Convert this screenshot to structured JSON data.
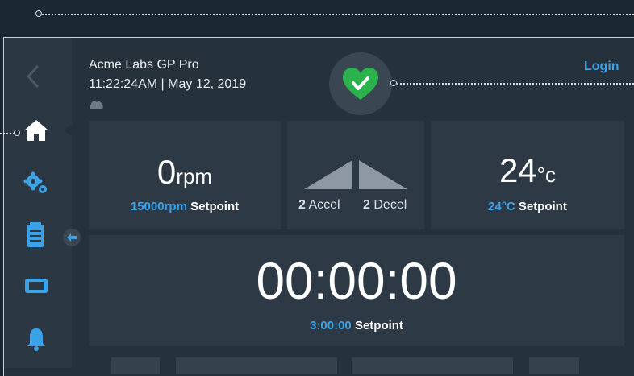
{
  "header": {
    "title": "Acme Labs GP Pro",
    "datetime": "11:22:24AM | May 12, 2019",
    "login_label": "Login"
  },
  "icons": {
    "back": "chevron-left-icon",
    "home": "home-icon",
    "settings": "gears-icon",
    "programs": "clipboard-icon",
    "rotor": "rotor-icon",
    "alerts": "bell-icon",
    "collapse": "arrow-left-icon",
    "cloud": "cloud-icon",
    "status": "heart-check-icon"
  },
  "speed": {
    "value": "0",
    "unit": "rpm",
    "setpoint_value": "15000rpm",
    "setpoint_label": "Setpoint"
  },
  "ramp": {
    "accel_value": "2",
    "accel_label": "Accel",
    "decel_value": "2",
    "decel_label": "Decel"
  },
  "temperature": {
    "value": "24",
    "unit": "°c",
    "setpoint_value": "24°C",
    "setpoint_label": "Setpoint"
  },
  "timer": {
    "value": "00:00:00",
    "setpoint_value": "3:00:00",
    "setpoint_label": "Setpoint"
  },
  "colors": {
    "accent": "#3aa3e8",
    "status_green": "#2bb24c",
    "background": "#25313b"
  }
}
